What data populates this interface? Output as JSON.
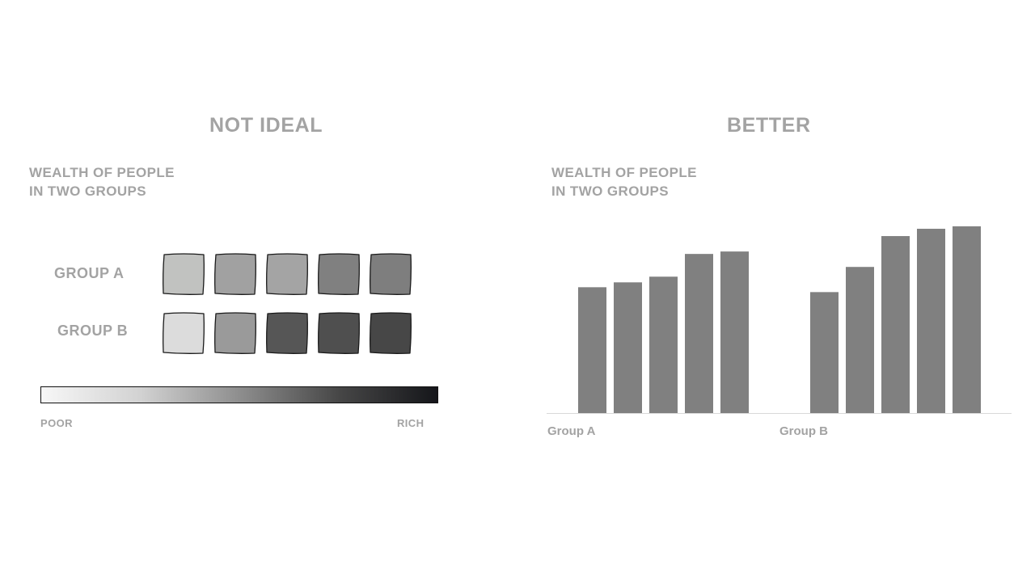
{
  "left_panel": {
    "title": "NOT IDEAL",
    "subtitle_line1": "WEALTH OF PEOPLE",
    "subtitle_line2": "IN TWO GROUPS",
    "groups": [
      {
        "label": "GROUP A",
        "shades": [
          "#c1c2c0",
          "#a1a1a1",
          "#a4a4a4",
          "#808080",
          "#7e7e7e"
        ]
      },
      {
        "label": "GROUP B",
        "shades": [
          "#dcdcdc",
          "#9a9a9a",
          "#565656",
          "#4f4f4f",
          "#474747"
        ]
      }
    ],
    "scale_poor": "POOR",
    "scale_rich": "RICH"
  },
  "right_panel": {
    "title": "BETTER",
    "subtitle_line1": "WEALTH OF PEOPLE",
    "subtitle_line2": "IN TWO GROUPS"
  },
  "colors": {
    "bar": "#808080",
    "baseline": "#d9d9d9"
  },
  "chart_data": {
    "type": "bar",
    "title": "WEALTH OF PEOPLE IN TWO GROUPS",
    "categories": [
      "Group A",
      "Group B"
    ],
    "series_values": [
      [
        155,
        161,
        168,
        196,
        199
      ],
      [
        149,
        180,
        218,
        227,
        230
      ]
    ],
    "ylim": [
      0,
      230
    ],
    "grid": false,
    "legend": "none"
  }
}
